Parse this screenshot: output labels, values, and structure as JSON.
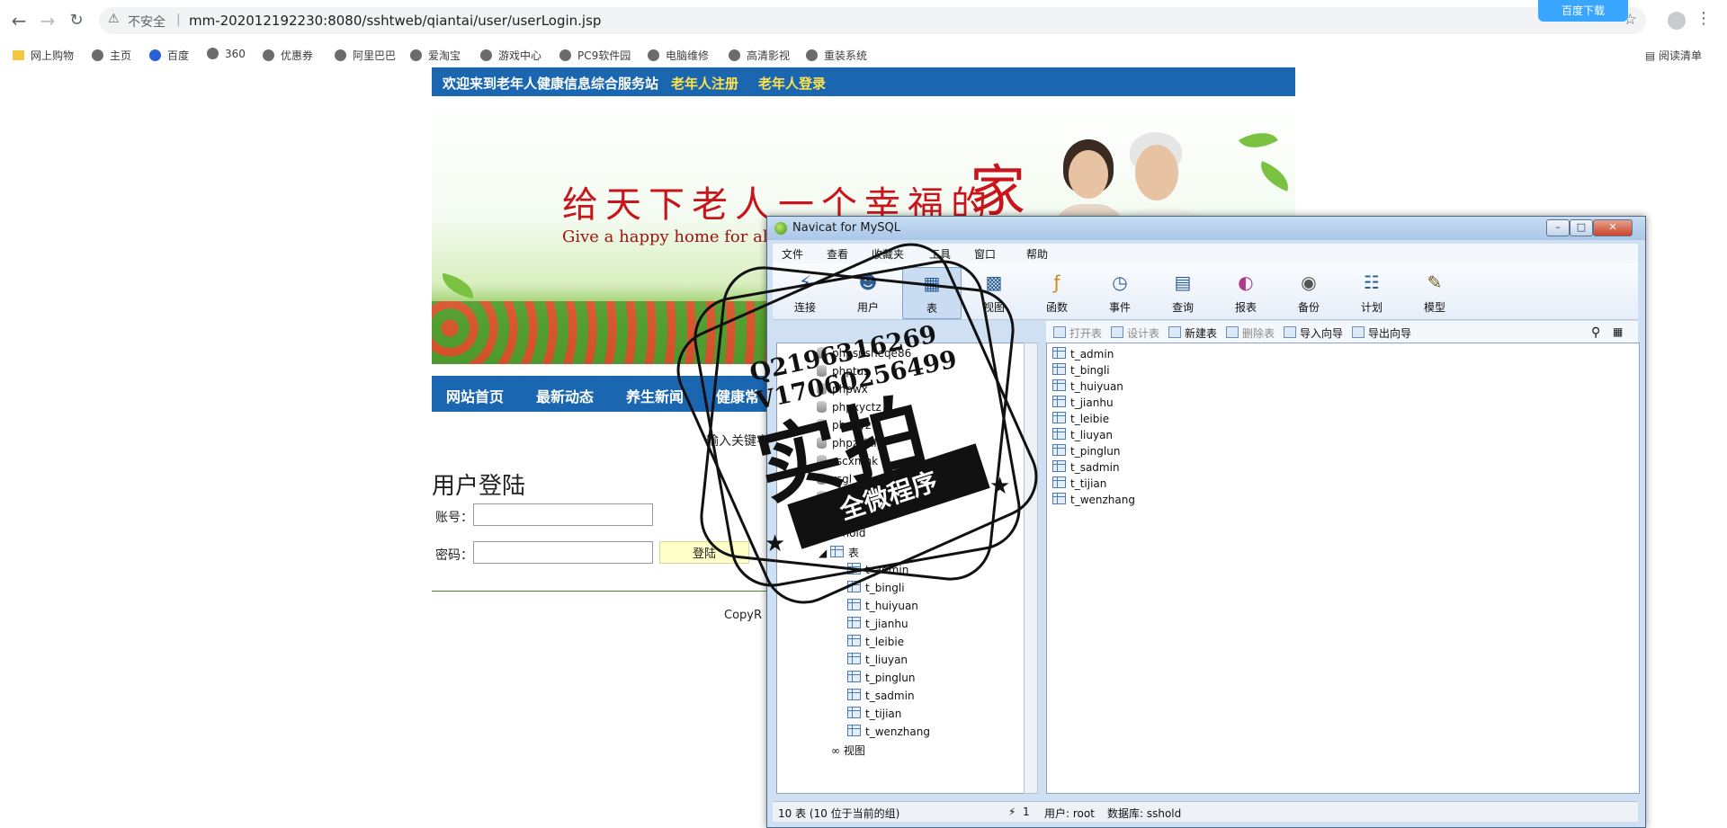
{
  "browser": {
    "insecure_label": "不安全",
    "url": "mm-202012192230:8080/sshtweb/qiantai/user/userLogin.jsp",
    "extension_badge": "百度下载",
    "reading_list": "阅读清单",
    "bookmarks": [
      "网上购物",
      "主页",
      "百度",
      "360",
      "优惠券",
      "阿里巴巴",
      "爱淘宝",
      "游戏中心",
      "PC9软件园",
      "电脑维修",
      "高清影视",
      "重装系统"
    ]
  },
  "site": {
    "welcome": "欢迎来到老年人健康信息综合服务站",
    "register_link": "老年人注册",
    "login_link": "老年人登录",
    "slogan_cn": "给天下老人一个幸福的",
    "slogan_jia": "家",
    "slogan_en": "Give a happy home for al",
    "nav": [
      "网站首页",
      "最新动态",
      "养生新闻",
      "健康常"
    ],
    "search_label": "输入关键字",
    "login_title": "用户登陆",
    "account_label": "账号：",
    "password_label": "密码：",
    "login_button": "登陆",
    "copyright": "CopyR"
  },
  "navicat": {
    "title": "Navicat for MySQL",
    "menu": [
      "文件",
      "查看",
      "收藏夹",
      "工具",
      "窗口",
      "帮助"
    ],
    "toolbar": [
      "连接",
      "用户",
      "表",
      "视图",
      "函数",
      "事件",
      "查询",
      "报表",
      "备份",
      "计划",
      "模型"
    ],
    "subtoolbar": [
      "打开表",
      "设计表",
      "新建表",
      "删除表",
      "导入向导",
      "导出向导"
    ],
    "tree_dbs": [
      "phpsusheqe86",
      "phptus",
      "phpwx",
      "phpxyctz",
      "phpxyz",
      "phpzslhly",
      "rscxmnk",
      "rsgl",
      "shiyan",
      "sjzgw"
    ],
    "tree_open_db": "sshold",
    "tree_tables_node": "表",
    "tree_views_node": "视图",
    "tables": [
      "t_admin",
      "t_bingli",
      "t_huiyuan",
      "t_jianhu",
      "t_leibie",
      "t_liuyan",
      "t_pinglun",
      "t_sadmin",
      "t_tijian",
      "t_wenzhang"
    ],
    "status_count": "10 表 (10 位于当前的组)",
    "status_conn": "1",
    "status_user": "用户: root",
    "status_db": "数据库: sshold"
  },
  "watermark": {
    "qq": "Q2196316269",
    "vx": "V17060256499",
    "big": "实拍",
    "ribbon": "全微程序"
  }
}
